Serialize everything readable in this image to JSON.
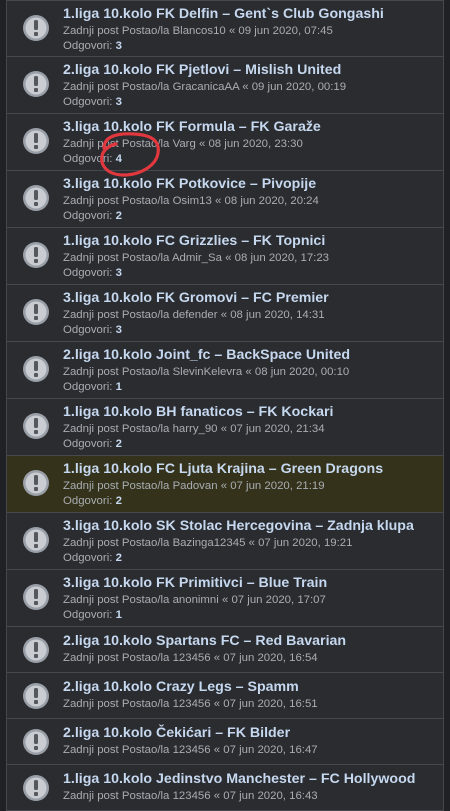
{
  "labels": {
    "last_post": "Zadnji post Postao/la",
    "replies": "Odgovori:",
    "icon": "topic-read-icon"
  },
  "topics": [
    {
      "title": "1.liga 10.kolo FK Delfin – Gent`s Club Gongashi",
      "user": "Blancos10",
      "date": "« 09 jun 2020, 07:45",
      "replies": "3",
      "highlight": false,
      "show_replies": true
    },
    {
      "title": "2.liga 10.kolo FK Pjetlovi – Mislish United",
      "user": "GracanicaAA",
      "date": "« 09 jun 2020, 00:19",
      "replies": "3",
      "highlight": false,
      "show_replies": true
    },
    {
      "title": "3.liga 10.kolo FK Formula – FK Garaže",
      "user": "Varg",
      "date": "« 08 jun 2020, 23:30",
      "replies": "4",
      "highlight": false,
      "show_replies": true
    },
    {
      "title": "3.liga 10.kolo FK Potkovice – Pivopije",
      "user": "Osim13",
      "date": "« 08 jun 2020, 20:24",
      "replies": "2",
      "highlight": false,
      "show_replies": true
    },
    {
      "title": "1.liga 10.kolo FC Grizzlies – FK Topnici",
      "user": "Admir_Sa",
      "date": "« 08 jun 2020, 17:23",
      "replies": "3",
      "highlight": false,
      "show_replies": true
    },
    {
      "title": "3.liga 10.kolo FK Gromovi – FC Premier",
      "user": "defender",
      "date": "« 08 jun 2020, 14:31",
      "replies": "3",
      "highlight": false,
      "show_replies": true
    },
    {
      "title": "2.liga 10.kolo Joint_fc – BackSpace United",
      "user": "SlevinKelevra",
      "date": "« 08 jun 2020, 00:10",
      "replies": "1",
      "highlight": false,
      "show_replies": true
    },
    {
      "title": "1.liga 10.kolo BH fanaticos – FK Kockari",
      "user": "harry_90",
      "date": "« 07 jun 2020, 21:34",
      "replies": "2",
      "highlight": false,
      "show_replies": true
    },
    {
      "title": "1.liga 10.kolo FC Ljuta Krajina – Green Dragons",
      "user": "Padovan",
      "date": "« 07 jun 2020, 21:19",
      "replies": "2",
      "highlight": true,
      "show_replies": true
    },
    {
      "title": "3.liga 10.kolo SK Stolac Hercegovina – Zadnja klupa",
      "user": "Bazinga12345",
      "date": "« 07 jun 2020, 19:21",
      "replies": "2",
      "highlight": false,
      "show_replies": true
    },
    {
      "title": "3.liga 10.kolo FK Primitivci – Blue Train",
      "user": "anonimni",
      "date": "« 07 jun 2020, 17:07",
      "replies": "1",
      "highlight": false,
      "show_replies": true
    },
    {
      "title": "2.liga 10.kolo Spartans FC – Red Bavarian",
      "user": "123456",
      "date": "« 07 jun 2020, 16:54",
      "replies": "",
      "highlight": false,
      "show_replies": false
    },
    {
      "title": "2.liga 10.kolo Crazy Legs – Spamm",
      "user": "123456",
      "date": "« 07 jun 2020, 16:51",
      "replies": "",
      "highlight": false,
      "show_replies": false
    },
    {
      "title": "2.liga 10.kolo Čekićari – FK Bilder",
      "user": "123456",
      "date": "« 07 jun 2020, 16:47",
      "replies": "",
      "highlight": false,
      "show_replies": false
    },
    {
      "title": "1.liga 10.kolo Jedinstvo Manchester – FC Hollywood",
      "user": "123456",
      "date": "« 07 jun 2020, 16:43",
      "replies": "",
      "highlight": false,
      "show_replies": false
    }
  ],
  "colors": {
    "background": "#1f2124",
    "row": "#2a2c30",
    "row_highlight": "#34321a",
    "title": "#c6d8ef",
    "annotation": "#e0383e"
  }
}
